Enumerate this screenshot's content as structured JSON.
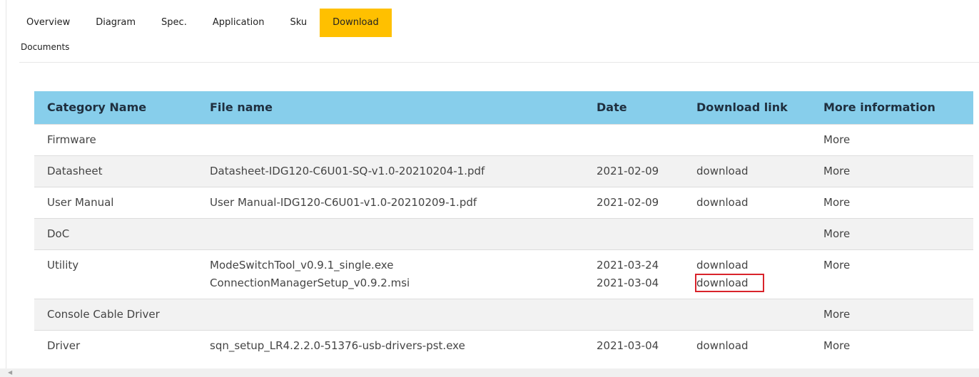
{
  "tabs": [
    {
      "label": "Overview"
    },
    {
      "label": "Diagram"
    },
    {
      "label": "Spec."
    },
    {
      "label": "Application"
    },
    {
      "label": "Sku"
    },
    {
      "label": "Download"
    }
  ],
  "section_label": "Documents",
  "table": {
    "headers": [
      "Category Name",
      "File name",
      "Date",
      "Download link",
      "More information"
    ],
    "rows": [
      {
        "category": "Firmware",
        "files": [],
        "more": "More"
      },
      {
        "category": "Datasheet",
        "files": [
          {
            "name": "Datasheet-IDG120-C6U01-SQ-v1.0-20210204-1.pdf",
            "date": "2021-02-09",
            "link": "download"
          }
        ],
        "more": "More"
      },
      {
        "category": "User Manual",
        "files": [
          {
            "name": "User Manual-IDG120-C6U01-v1.0-20210209-1.pdf",
            "date": "2021-02-09",
            "link": "download"
          }
        ],
        "more": "More"
      },
      {
        "category": "DoC",
        "files": [],
        "more": "More"
      },
      {
        "category": "Utility",
        "files": [
          {
            "name": "ModeSwitchTool_v0.9.1_single.exe",
            "date": "2021-03-24",
            "link": "download"
          },
          {
            "name": "ConnectionManagerSetup_v0.9.2.msi",
            "date": "2021-03-04",
            "link": "download"
          }
        ],
        "more": "More"
      },
      {
        "category": "Console Cable Driver",
        "files": [],
        "more": "More"
      },
      {
        "category": "Driver",
        "files": [
          {
            "name": "sqn_setup_LR4.2.2.0-51376-usb-drivers-pst.exe",
            "date": "2021-03-04",
            "link": "download"
          }
        ],
        "more": "More"
      }
    ]
  },
  "colors": {
    "active_tab": "#ffc000",
    "table_header": "#87ceeb",
    "highlight_box": "#d9232b"
  },
  "scrollbar": {
    "left_arrow_icon": "chevron-left-icon"
  }
}
